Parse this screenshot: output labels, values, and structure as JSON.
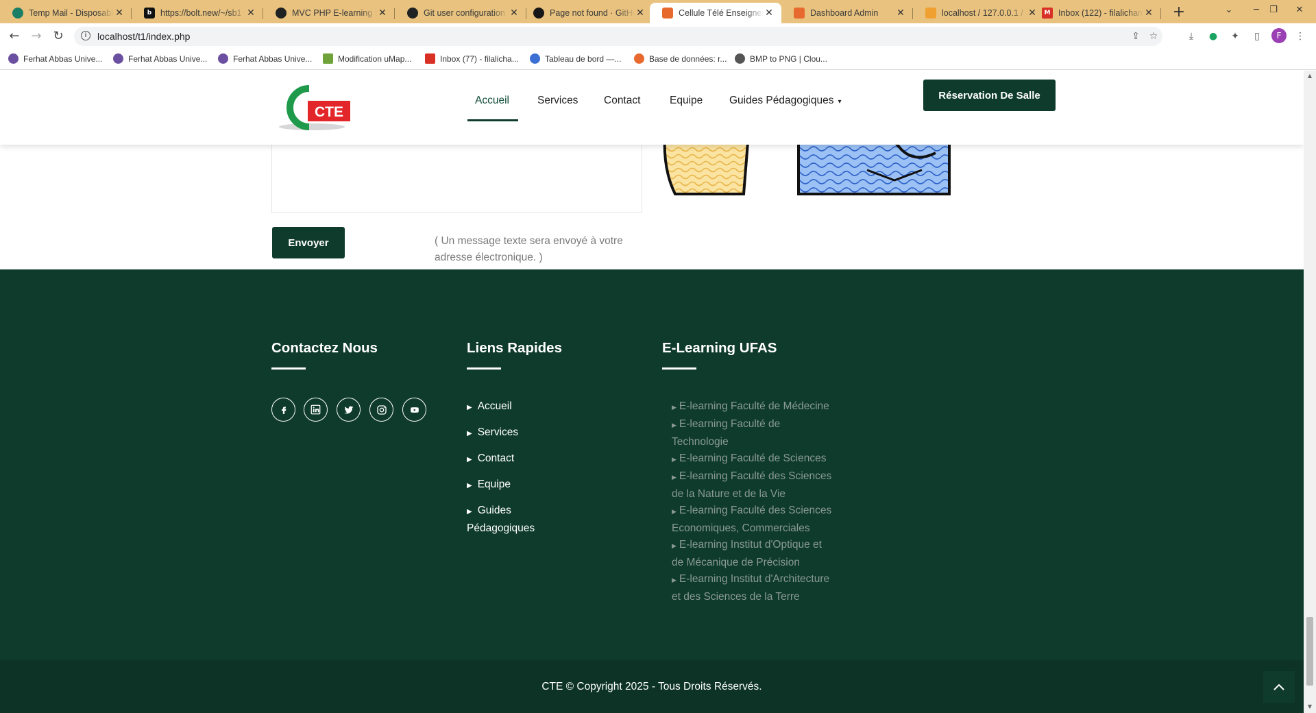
{
  "browser": {
    "tabs": [
      {
        "title": "Temp Mail - Disposable",
        "favicon_color": "#1a7f64",
        "icon": "tempmail-favicon"
      },
      {
        "title": "https://bolt.new/~/sb1",
        "favicon_color": "#111111",
        "icon": "bolt-favicon"
      },
      {
        "title": "MVC PHP E-learning Sc",
        "favicon_color": "#202123",
        "icon": "chatgpt-favicon"
      },
      {
        "title": "Git user configuration",
        "favicon_color": "#202123",
        "icon": "chatgpt-favicon"
      },
      {
        "title": "Page not found · GitHu",
        "favicon_color": "#181717",
        "icon": "github-favicon"
      },
      {
        "title": "Cellule Télé Enseignem",
        "favicon_color": "#e8692d",
        "icon": "site-favicon",
        "active": true
      },
      {
        "title": "Dashboard Admin",
        "favicon_color": "#e8692d",
        "icon": "site-favicon"
      },
      {
        "title": "localhost / 127.0.0.1 / s",
        "favicon_color": "#f0a030",
        "icon": "phpmyadmin-favicon"
      },
      {
        "title": "Inbox (122) - filalicham",
        "favicon_color": "#d93025",
        "icon": "gmail-favicon"
      }
    ],
    "url": "localhost/t1/index.php",
    "profile_initial": "F",
    "bookmarks": [
      {
        "label": "Ferhat Abbas Unive...",
        "color": "#6b4fa0"
      },
      {
        "label": "Ferhat Abbas Unive...",
        "color": "#6b4fa0"
      },
      {
        "label": "Ferhat Abbas Unive...",
        "color": "#6b4fa0"
      },
      {
        "label": "Modification uMap...",
        "color": "#6fa33a"
      },
      {
        "label": "Inbox (77) - filalicha...",
        "color": "#d93025"
      },
      {
        "label": "Tableau de bord —...",
        "color": "#3b6fd4"
      },
      {
        "label": "Base de données: r...",
        "color": "#e8692d"
      },
      {
        "label": "BMP to PNG | Clou...",
        "color": "#555555"
      }
    ]
  },
  "header": {
    "logo_text": "CTE",
    "nav": [
      {
        "label": "Accueil",
        "active": true
      },
      {
        "label": "Services"
      },
      {
        "label": "Contact"
      },
      {
        "label": "Equipe"
      },
      {
        "label": "Guides Pédagogiques",
        "dropdown": true
      }
    ],
    "cta_label": "Réservation De Salle"
  },
  "form": {
    "submit_label": "Envoyer",
    "note": "( Un message texte sera envoyé à votre adresse électronique. )"
  },
  "footer": {
    "contact_title": "Contactez Nous",
    "social_icons": [
      "facebook-icon",
      "linkedin-icon",
      "twitter-icon",
      "instagram-icon",
      "youtube-icon"
    ],
    "quick_title": "Liens Rapides",
    "quick_links": [
      "Accueil",
      "Services",
      "Contact",
      "Equipe",
      "Guides Pédagogiques"
    ],
    "elearning_title": "E-Learning UFAS",
    "elearning_links": [
      "E-learning Faculté de Médecine",
      "E-learning Faculté de Technologie",
      "E-learning Faculté de Sciences",
      "E-learning Faculté des Sciences de la Nature et de la Vie",
      "E-learning Faculté des Sciences Economiques, Commerciales",
      "E-learning Institut d'Optique et de Mécanique de Précision",
      "E-learning Institut d'Architecture et des Sciences de la Terre"
    ],
    "copyright": "CTE © Copyright 2025 - Tous Droits Réservés."
  },
  "colors": {
    "primary": "#0f3b2d",
    "tabbar": "#e8c27e"
  }
}
